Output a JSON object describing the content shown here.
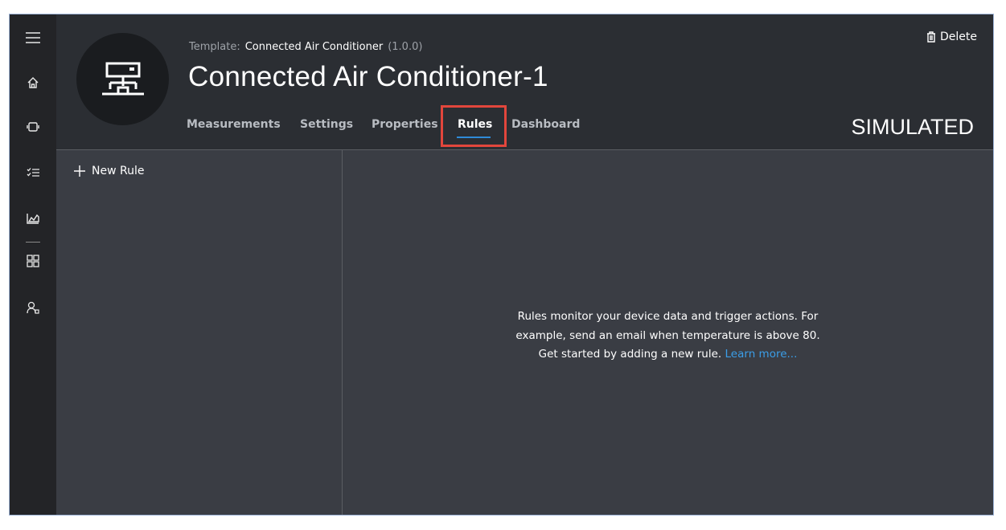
{
  "nav": {
    "items": [
      "menu-icon",
      "home-icon",
      "device-icon",
      "tasks-icon",
      "analytics-icon",
      "dashboard-icon",
      "users-icon"
    ]
  },
  "header": {
    "template_prefix": "Template:",
    "template_name": "Connected Air Conditioner",
    "template_version": "(1.0.0)",
    "device_name": "Connected Air Conditioner-1",
    "delete_label": "Delete",
    "status": "SIMULATED",
    "tabs": [
      {
        "label": "Measurements",
        "active": false
      },
      {
        "label": "Settings",
        "active": false
      },
      {
        "label": "Properties",
        "active": false
      },
      {
        "label": "Rules",
        "active": true
      },
      {
        "label": "Dashboard",
        "active": false
      }
    ]
  },
  "rules": {
    "new_rule_label": "New Rule",
    "empty_line1": "Rules monitor your device data and trigger actions. For",
    "empty_line2": "example, send an email when temperature is above 80.",
    "empty_line3": "Get started by adding a new rule.",
    "learn_more": "Learn more..."
  },
  "colors": {
    "accent": "#2f8bd8",
    "link": "#3b9ee8",
    "highlight": "#e2463c"
  }
}
